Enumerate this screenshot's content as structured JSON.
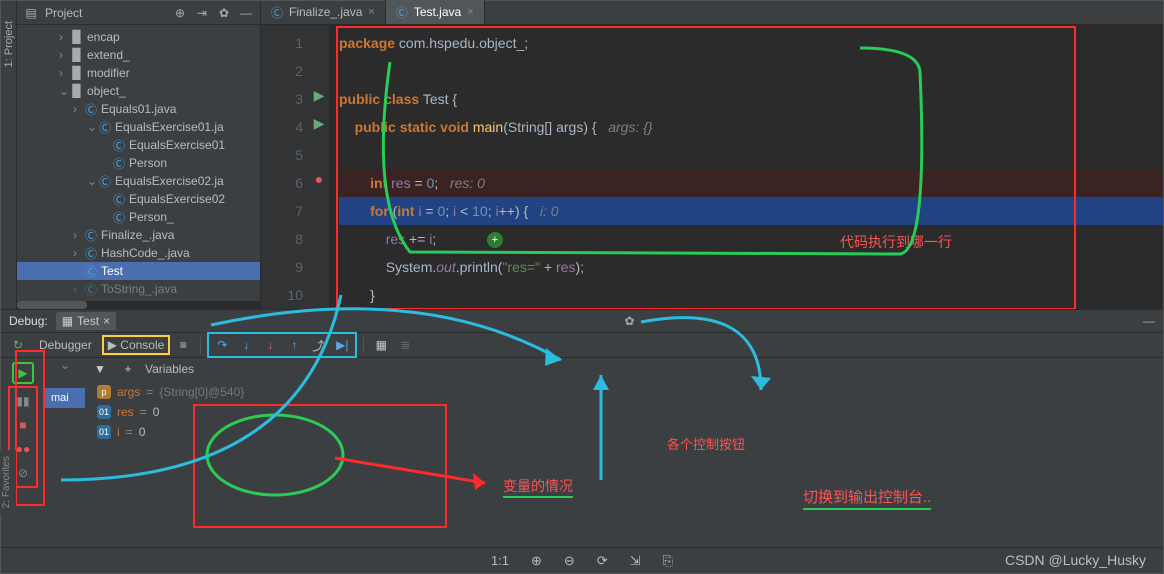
{
  "sidebar_left_label": "1: Project",
  "favorites_label": "2: Favorites",
  "project": {
    "title": "Project",
    "items": [
      {
        "indent": 3,
        "arrow": "›",
        "icon": "folder",
        "label": "encap"
      },
      {
        "indent": 3,
        "arrow": "›",
        "icon": "folder",
        "label": "extend_"
      },
      {
        "indent": 3,
        "arrow": "›",
        "icon": "folder",
        "label": "modifier"
      },
      {
        "indent": 3,
        "arrow": "⌄",
        "icon": "folder",
        "label": "object_"
      },
      {
        "indent": 4,
        "arrow": "›",
        "icon": "java",
        "label": "Equals01.java"
      },
      {
        "indent": 5,
        "arrow": "⌄",
        "icon": "java",
        "label": "EqualsExercise01.ja"
      },
      {
        "indent": 6,
        "arrow": "",
        "icon": "java",
        "label": "EqualsExercise01"
      },
      {
        "indent": 6,
        "arrow": "",
        "icon": "java",
        "label": "Person"
      },
      {
        "indent": 5,
        "arrow": "⌄",
        "icon": "java",
        "label": "EqualsExercise02.ja"
      },
      {
        "indent": 6,
        "arrow": "",
        "icon": "java",
        "label": "EqualsExercise02"
      },
      {
        "indent": 6,
        "arrow": "",
        "icon": "java",
        "label": "Person_"
      },
      {
        "indent": 4,
        "arrow": "›",
        "icon": "java",
        "label": "Finalize_.java"
      },
      {
        "indent": 4,
        "arrow": "›",
        "icon": "java",
        "label": "HashCode_.java"
      },
      {
        "indent": 4,
        "arrow": "",
        "icon": "java",
        "label": "Test",
        "sel": true
      },
      {
        "indent": 4,
        "arrow": "›",
        "icon": "java",
        "label": "ToString_.java",
        "dim": true
      }
    ]
  },
  "tabs": [
    {
      "label": "Finalize_.java",
      "active": false
    },
    {
      "label": "Test.java",
      "active": true
    }
  ],
  "code": {
    "package_kw": "package",
    "package_name": " com.hspedu.object_",
    "public": "public",
    "class_kw": "class",
    "class_name": "Test",
    "static": "static",
    "void": "void",
    "main": "main",
    "main_sig": "(String[] args) {",
    "args_hint": "args: {}",
    "int": "int",
    "res": "res",
    "zero": "0",
    "res_hint": "res: 0",
    "for": "for",
    "i": "i",
    "ten": "10",
    "ipp": "i++",
    "i_hint": "i: 0",
    "res_pluseq": "res += i;",
    "sys": "System",
    "out": "out",
    "println": "println",
    "str": "\"res=\"",
    "plus": " + ",
    "semi": ";"
  },
  "line_numbers": [
    "1",
    "2",
    "3",
    "4",
    "5",
    "6",
    "7",
    "8",
    "9",
    "10"
  ],
  "annotations": {
    "code_line": "代码执行到哪一行",
    "vars": "变量的情况",
    "controls": "各个控制按钮",
    "switch_console": "切换到输出控制台.."
  },
  "debug": {
    "title": "Debug:",
    "run_config": "Test",
    "tabs": {
      "debugger": "Debugger",
      "console": "Console"
    },
    "frames": {
      "main": "mai"
    },
    "vars_title": "Variables",
    "vars": [
      {
        "chip": "p",
        "name": "args",
        "eq": " = ",
        "val": "{String[0]@540}",
        "dim": true
      },
      {
        "chip": "01",
        "name": "res",
        "eq": " = ",
        "val": "0"
      },
      {
        "chip": "01",
        "name": "i",
        "eq": " = ",
        "val": "0"
      }
    ]
  },
  "status": {
    "ratio": "1:1"
  },
  "watermark": "CSDN @Lucky_Husky"
}
